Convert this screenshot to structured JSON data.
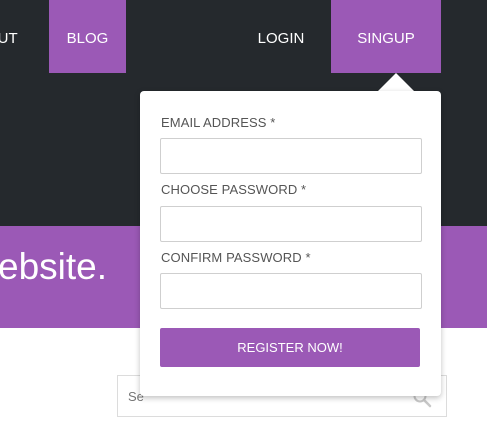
{
  "nav": {
    "about": "OUT",
    "blog": "BLOG",
    "login": "LOGIN",
    "signup": "SINGUP"
  },
  "hero": {
    "text": "ebsite."
  },
  "search": {
    "placeholder": "Se"
  },
  "signup_form": {
    "email_label": "EMAIL ADDRESS *",
    "password_label": "CHOOSE PASSWORD *",
    "confirm_label": "CONFIRM PASSWORD *",
    "email_value": "",
    "password_value": "",
    "confirm_value": "",
    "submit_label": "REGISTER NOW!"
  },
  "colors": {
    "accent": "#9b59b6",
    "nav_background": "#25292d"
  }
}
